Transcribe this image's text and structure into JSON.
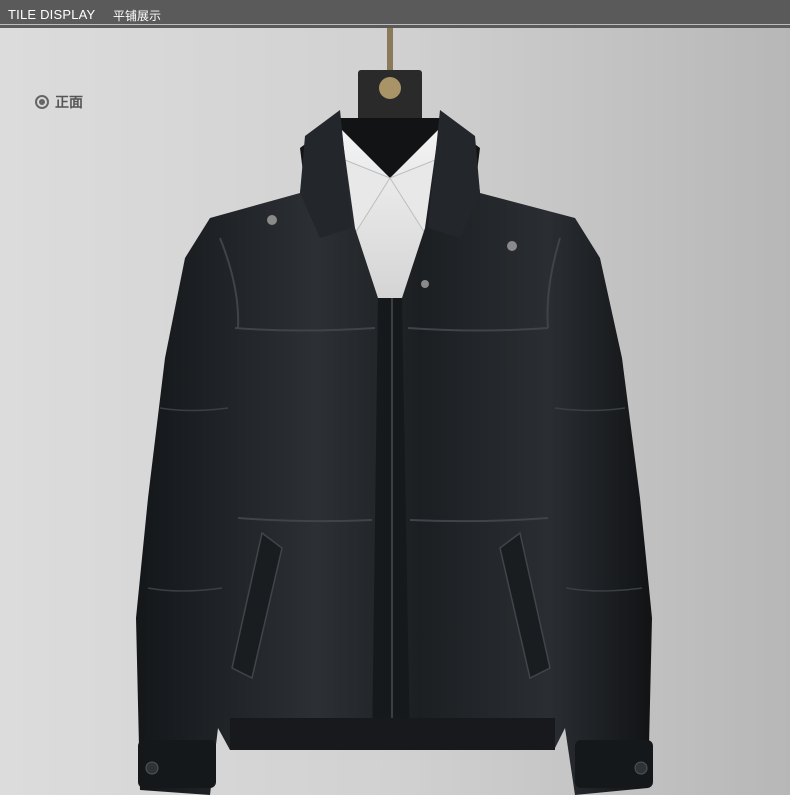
{
  "header": {
    "title": "TILE DISPLAY",
    "subtitle": "平铺展示",
    "band_color": "#5a5a5a"
  },
  "view": {
    "label": "正面",
    "icon": "radio-dot-icon"
  },
  "product": {
    "icon": "leather-jacket-icon",
    "color": "#1c1f22"
  }
}
